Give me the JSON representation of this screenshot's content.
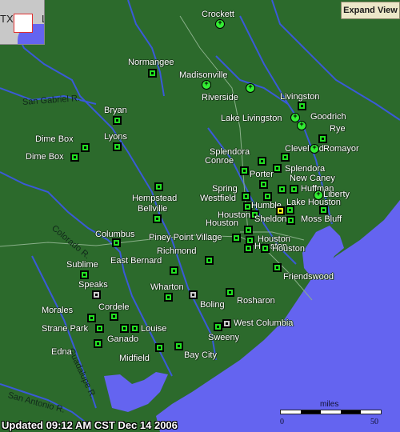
{
  "expand_button": "Expand View",
  "updated_text": "Updated 09:12 AM CST Dec 14 2006",
  "inset": {
    "state_label": "TX",
    "right_label": "L"
  },
  "scale": {
    "unit": "miles",
    "min": "0",
    "max": "50"
  },
  "colors": {
    "land": "#2c6a2c",
    "water": "#6464f0",
    "river": "#3a5ad8",
    "marker_green": "#22e022",
    "marker_gray": "#cccccc",
    "marker_yellow": "#f0f020"
  },
  "rivers": [
    {
      "name": "San Gabriel R."
    },
    {
      "name": "Colorado R."
    },
    {
      "name": "Guadalupe R."
    },
    {
      "name": "San Antonio R."
    }
  ],
  "stations": [
    {
      "name": "Crockett",
      "type": "circle"
    },
    {
      "name": "Normangee",
      "type": "green"
    },
    {
      "name": "Madisonville",
      "type": "circle"
    },
    {
      "name": "Riverside",
      "type": "circle"
    },
    {
      "name": "Livingston",
      "type": "green"
    },
    {
      "name": "Lake Livingston",
      "type": "circle"
    },
    {
      "name": "Goodrich",
      "type": "circle"
    },
    {
      "name": "Rye",
      "type": "green"
    },
    {
      "name": "Bryan",
      "type": "green"
    },
    {
      "name": "Lyons",
      "type": "green"
    },
    {
      "name": "Dime Box",
      "type": "green"
    },
    {
      "name": "Dime Box",
      "type": "green"
    },
    {
      "name": "Cleveland",
      "type": "green"
    },
    {
      "name": "Romayor",
      "type": "circle"
    },
    {
      "name": "Splendora",
      "type": "green"
    },
    {
      "name": "Conroe",
      "type": "green"
    },
    {
      "name": "Splendora",
      "type": "green"
    },
    {
      "name": "Porter",
      "type": "green"
    },
    {
      "name": "New Caney",
      "type": "green"
    },
    {
      "name": "Huffman",
      "type": "green"
    },
    {
      "name": "Spring",
      "type": "green"
    },
    {
      "name": "Westfield",
      "type": "green"
    },
    {
      "name": "Liberty",
      "type": "circle"
    },
    {
      "name": "Humble",
      "type": "green"
    },
    {
      "name": "Lake Houston",
      "type": "green"
    },
    {
      "name": "Hempstead",
      "type": "green"
    },
    {
      "name": "Houston",
      "type": "green"
    },
    {
      "name": "Houston",
      "type": "yellow"
    },
    {
      "name": "Sheldon",
      "type": "green"
    },
    {
      "name": "Moss Bluff",
      "type": "green"
    },
    {
      "name": "Bellville",
      "type": "green"
    },
    {
      "name": "Houston",
      "type": "green"
    },
    {
      "name": "Columbus",
      "type": "green"
    },
    {
      "name": "Piney Point Village",
      "type": "green"
    },
    {
      "name": "Houston",
      "type": "green"
    },
    {
      "name": "Houston",
      "type": "green"
    },
    {
      "name": "Richmond",
      "type": "green"
    },
    {
      "name": "Houston",
      "type": "green"
    },
    {
      "name": "Sublime",
      "type": "green"
    },
    {
      "name": "East Bernard",
      "type": "green"
    },
    {
      "name": "Friendswood",
      "type": "green"
    },
    {
      "name": "Speaks",
      "type": "gray"
    },
    {
      "name": "Wharton",
      "type": "green"
    },
    {
      "name": "Boling",
      "type": "gray"
    },
    {
      "name": "Rosharon",
      "type": "green"
    },
    {
      "name": "Morales",
      "type": "green"
    },
    {
      "name": "Cordele",
      "type": "green"
    },
    {
      "name": "West Columbia",
      "type": "gray"
    },
    {
      "name": "Strane Park",
      "type": "green"
    },
    {
      "name": "Ganado",
      "type": "green"
    },
    {
      "name": "Louise",
      "type": "green"
    },
    {
      "name": "Sweeny",
      "type": "green"
    },
    {
      "name": "Edna",
      "type": "green"
    },
    {
      "name": "Midfield",
      "type": "green"
    },
    {
      "name": "Bay City",
      "type": "green"
    }
  ]
}
